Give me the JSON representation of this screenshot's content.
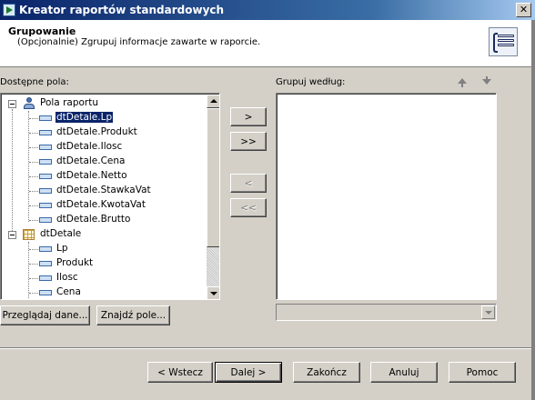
{
  "window": {
    "title": "Kreator raportów standardowych",
    "close_glyph": "✕"
  },
  "header": {
    "title": "Grupowanie",
    "subtitle": "(Opcjonalnie) Zgrupuj informacje zawarte w raporcie.",
    "icon": "group-icon"
  },
  "available_fields": {
    "label": "Dostępne pola:",
    "tree": {
      "report_group": {
        "label": "Pola raportu",
        "icon": "report-fields-icon",
        "items": [
          "dtDetale.Lp",
          "dtDetale.Produkt",
          "dtDetale.Ilosc",
          "dtDetale.Cena",
          "dtDetale.Netto",
          "dtDetale.StawkaVat",
          "dtDetale.KwotaVat",
          "dtDetale.Brutto"
        ],
        "selected": "dtDetale.Lp"
      },
      "table_group": {
        "label": "dtDetale",
        "icon": "table-icon",
        "items": [
          "Lp",
          "Produkt",
          "Ilosc",
          "Cena"
        ]
      }
    },
    "browse_button": "Przeglądaj dane...",
    "find_button": "Znajdź pole..."
  },
  "transfer_buttons": {
    "add": ">",
    "add_all": ">>",
    "remove": "<",
    "remove_all": "<<"
  },
  "group_by": {
    "label": "Grupuj według:",
    "items": [],
    "sort_value": ""
  },
  "footer": {
    "back": "< Wstecz",
    "next": "Dalej >",
    "finish": "Zakończ",
    "cancel": "Anuluj",
    "help": "Pomoc"
  },
  "colors": {
    "selection": "#0a246a",
    "titlebar_start": "#0a246a",
    "titlebar_end": "#a6caf0",
    "face": "#d4d0c8"
  }
}
